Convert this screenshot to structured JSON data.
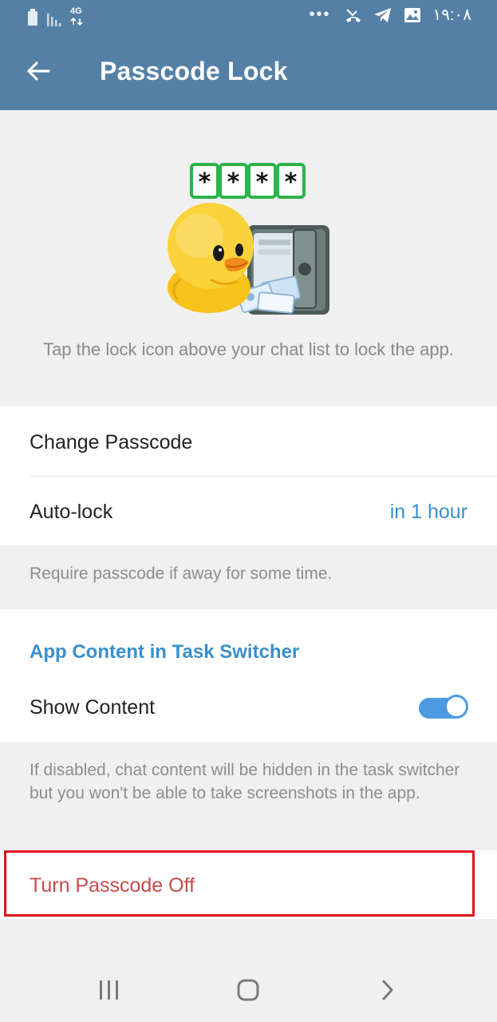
{
  "status_bar": {
    "network": "4G",
    "overflow": "•••",
    "time": "۱۹:۰۸",
    "icons": [
      "battery-icon",
      "signal-icon",
      "missed-call-icon",
      "telegram-icon",
      "gallery-icon"
    ]
  },
  "app_bar": {
    "title": "Passcode Lock",
    "back_icon": "arrow-left-icon"
  },
  "hero": {
    "sticker_code": [
      "*",
      "*",
      "*",
      "*"
    ],
    "description": "Tap the lock icon above your chat list to lock the app."
  },
  "settings": {
    "change_passcode": "Change Passcode",
    "auto_lock": {
      "label": "Auto-lock",
      "value": "in 1 hour"
    },
    "auto_lock_info": "Require passcode if away for some time."
  },
  "task_switcher": {
    "header": "App Content in Task Switcher",
    "show_content": {
      "label": "Show Content",
      "enabled": true
    },
    "info": "If disabled, chat content will be hidden in the task switcher but you won't be able to take screenshots in the app."
  },
  "danger": {
    "turn_off": "Turn Passcode Off"
  },
  "colors": {
    "app_bar": "#5580a6",
    "accent": "#3a8fcc",
    "danger": "#c94a4a",
    "highlight": "#e0161c",
    "toggle_on": "#4c9be0"
  },
  "nav_bar": {
    "icons": [
      "recents-icon",
      "home-icon",
      "back-icon"
    ]
  }
}
